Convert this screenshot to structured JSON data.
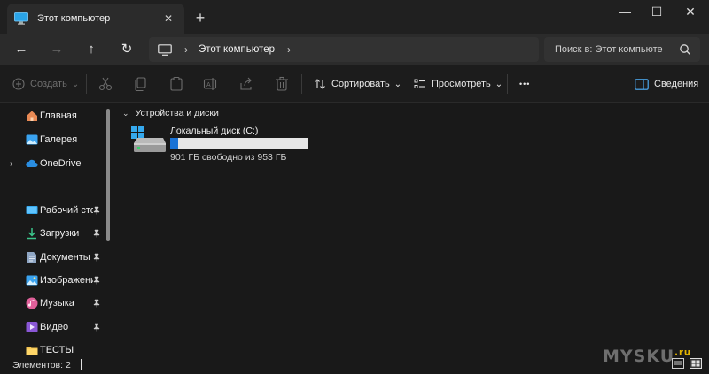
{
  "window": {
    "tab_title": "Этот компьютер",
    "tab_close": "✕",
    "new_tab": "+",
    "minimize": "—",
    "maximize": "☐",
    "close": "✕"
  },
  "nav": {
    "back": "←",
    "forward": "→",
    "up": "↑",
    "refresh": "↻",
    "breadcrumb": "Этот компьютер",
    "chevron": "›",
    "search_placeholder": "Поиск в: Этот компьюте"
  },
  "toolbar": {
    "create_label": "Создать",
    "sort_label": "Сортировать",
    "view_label": "Просмотреть",
    "more": "•••",
    "details_label": "Сведения",
    "dropdown": "⌄"
  },
  "sidebar": {
    "quick": [
      {
        "label": "Главная",
        "icon": "home-icon"
      },
      {
        "label": "Галерея",
        "icon": "gallery-icon"
      },
      {
        "label": "OneDrive",
        "icon": "cloud-icon",
        "expand": "›"
      }
    ],
    "pinned": [
      {
        "label": "Рабочий сто.",
        "icon": "desktop-icon"
      },
      {
        "label": "Загрузки",
        "icon": "download-icon"
      },
      {
        "label": "Документы",
        "icon": "document-icon"
      },
      {
        "label": "Изображени",
        "icon": "picture-icon"
      },
      {
        "label": "Музыка",
        "icon": "music-icon"
      },
      {
        "label": "Видео",
        "icon": "video-icon"
      },
      {
        "label": "ТЕСТЫ",
        "icon": "folder-icon"
      }
    ]
  },
  "main": {
    "group_label": "Устройства и диски",
    "group_chevron": "⌄",
    "drive": {
      "name": "Локальный диск (C:)",
      "free_text": "901 ГБ свободно из 953 ГБ",
      "used_fraction": 0.055
    }
  },
  "status": {
    "count_text": "Элементов: 2"
  },
  "watermark": {
    "text": "MYSKU",
    "suffix": ".ru"
  },
  "colors": {
    "accent": "#1a73d6",
    "bar_bg": "#e6e6e6"
  }
}
